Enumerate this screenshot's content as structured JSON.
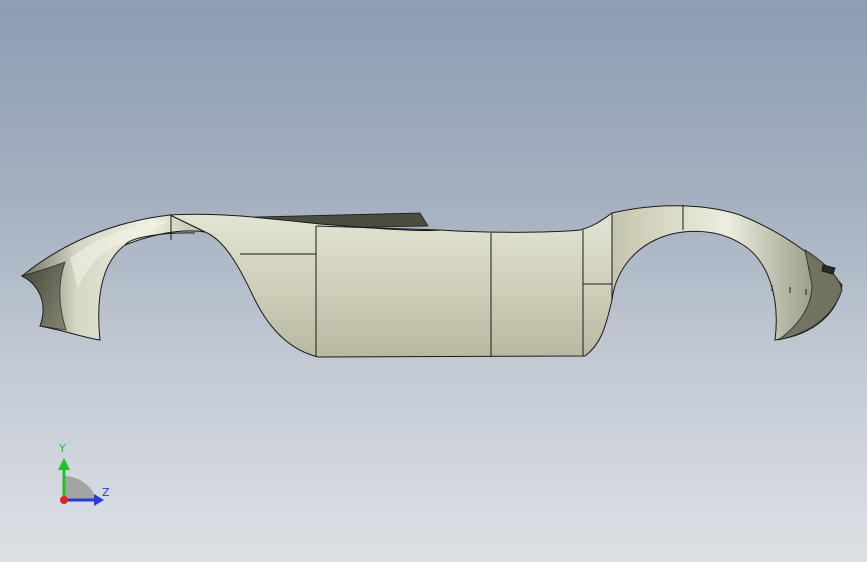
{
  "viewport": {
    "background_top": "#8d9db3",
    "background_bottom": "#dde1e6"
  },
  "model": {
    "description_icon": "car-body-shell-icon",
    "surface_color": "#c9c9b3",
    "edge_color": "#1a1a1a"
  },
  "triad": {
    "y_label": "Y",
    "z_label": "Z",
    "y_color": "#22c02a",
    "z_color": "#2a3ad8",
    "x_color": "#e02020"
  }
}
